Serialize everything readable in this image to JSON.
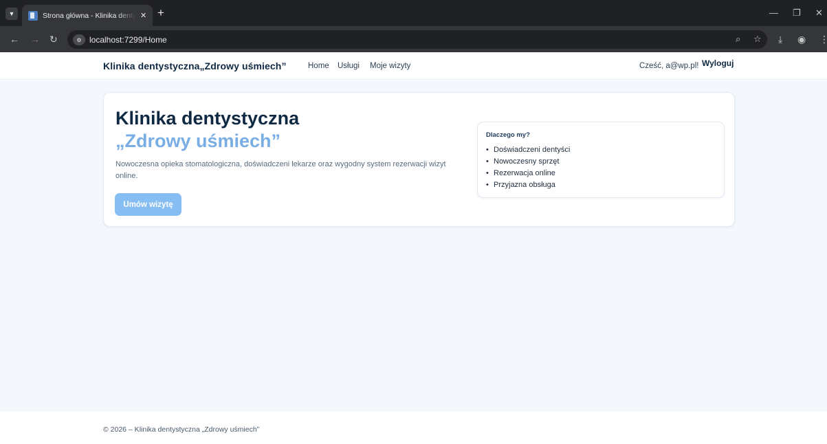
{
  "browser": {
    "tab_title": "Strona główna - Klinika dentystyczna „Zdrowy uśmiech”",
    "url": "localhost:7299/Home",
    "icons": {
      "tab_menu": "chevron-down-icon",
      "tab_close": "close-icon",
      "new_tab": "plus-icon",
      "back": "arrow-left-icon",
      "forward": "arrow-right-icon",
      "reload": "reload-icon",
      "site_info": "tune-icon",
      "zoom": "zoom-icon",
      "bookmark": "star-icon",
      "download": "download-icon",
      "profile": "profile-icon",
      "menu": "more-vertical-icon"
    }
  },
  "navbar": {
    "brand": "Klinika dentystyczna„Zdrowy uśmiech”",
    "links": [
      "Home",
      "Usługi",
      "Moje wizyty"
    ],
    "greeting": "Cześć, a@wp.pl!",
    "logout": "Wyloguj"
  },
  "hero": {
    "title": "Klinika dentystyczna",
    "subtitle": "„Zdrowy uśmiech”",
    "description": "Nowoczesna opieka stomatologiczna, doświadczeni lekarze oraz wygodny system rezerwacji wizyt online.",
    "cta": "Umów wizytę"
  },
  "why": {
    "title": "Dlaczego my?",
    "items": [
      "Doświadczeni dentyści",
      "Nowoczesny sprzęt",
      "Rezerwacja online",
      "Przyjazna obsługa"
    ]
  },
  "footer": {
    "text": "© 2026 – Klinika dentystyczna „Zdrowy uśmiech”"
  },
  "colors": {
    "brand_dark": "#0f2942",
    "accent": "#78aee3",
    "button": "#86bdf3",
    "page_bg": "#f4f8fd"
  }
}
